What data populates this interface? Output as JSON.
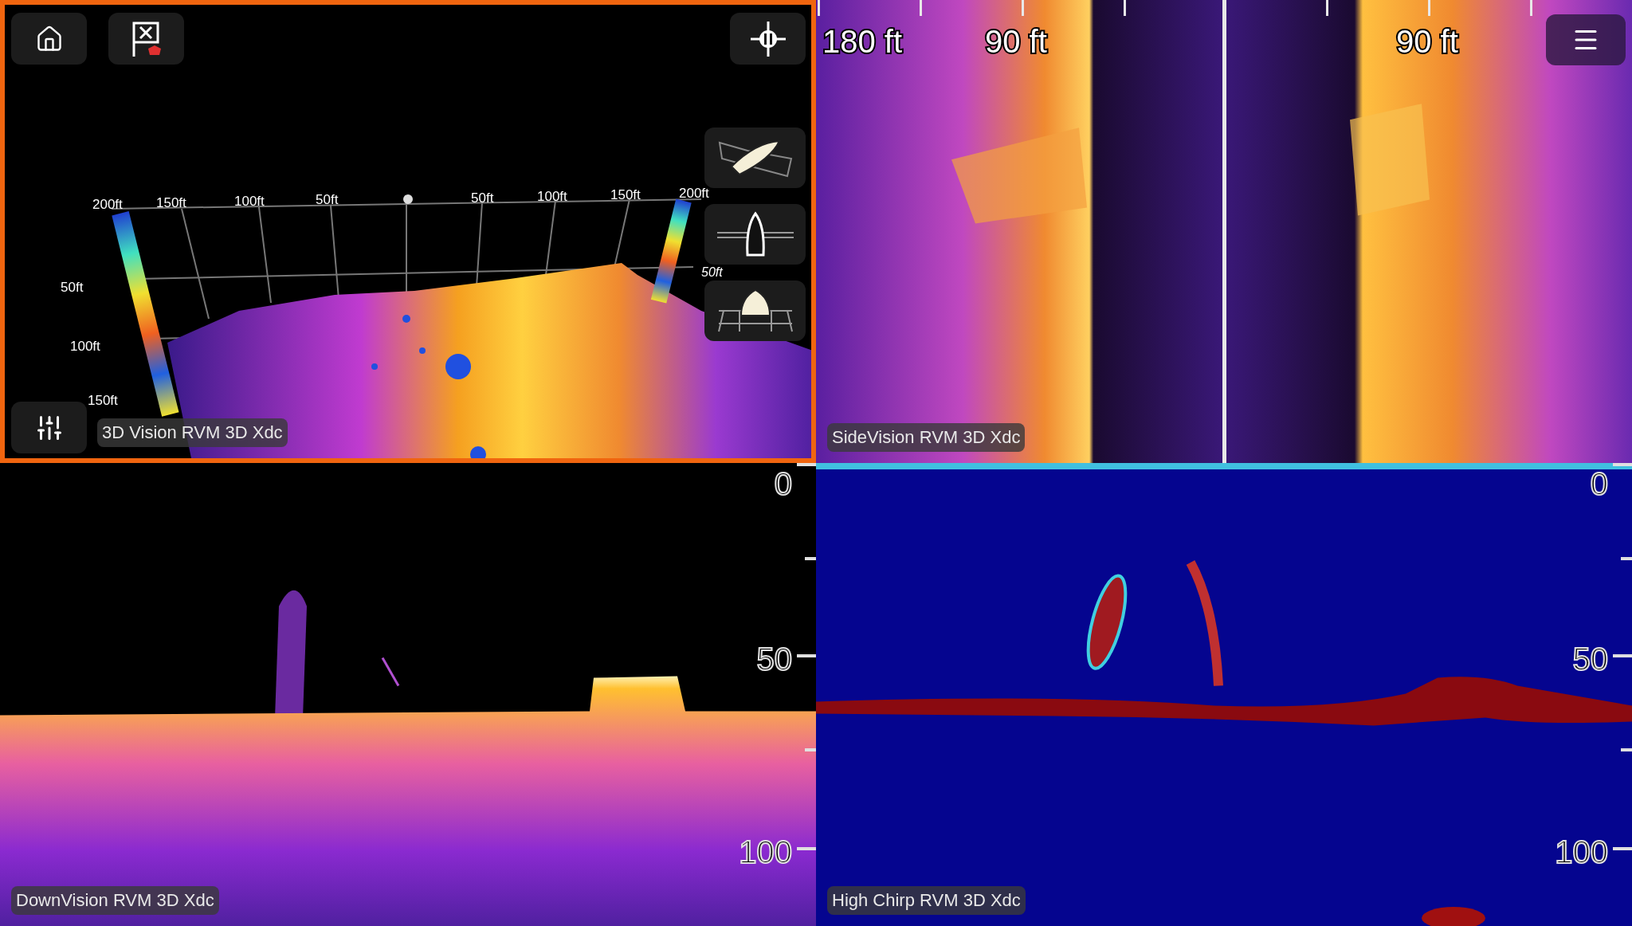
{
  "top_row": [
    {
      "kind": "perspective",
      "selected": true,
      "label": "3D Vision RVM 3D Xdc",
      "scene": {
        "range_labels": [
          "200ft",
          "150ft",
          "100ft",
          "50ft",
          "50ft",
          "100ft",
          "150ft",
          "200ft"
        ],
        "depth_labels": [
          "50ft",
          "100ft",
          "150ft"
        ],
        "right_depth_labels": [
          "50ft"
        ]
      }
    },
    {
      "kind": "side",
      "selected": false,
      "label": "SideVision RVM 3D Xdc",
      "range_labels": [
        "180 ft",
        "90 ft",
        "90 ft"
      ]
    }
  ],
  "bottom_row": [
    {
      "kind": "down",
      "selected": false,
      "label": "DownVision RVM 3D Xdc",
      "depth_scale": [
        "0",
        "50",
        "100"
      ]
    },
    {
      "kind": "chirp",
      "selected": false,
      "label": "High Chirp RVM 3D Xdc",
      "depth_scale": [
        "0",
        "50",
        "100"
      ]
    }
  ]
}
